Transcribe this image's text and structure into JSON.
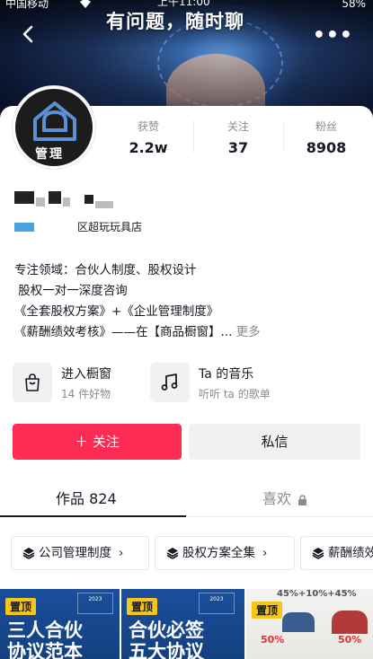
{
  "status_bar": {
    "carrier": "中国移动",
    "time": "上午11:00",
    "battery": "58%"
  },
  "banner": {
    "title": "有问题，随时聊",
    "more": "•••"
  },
  "avatar": {
    "label": "管理"
  },
  "stats": [
    {
      "label": "获赞",
      "value": "2.2w"
    },
    {
      "label": "关注",
      "value": "37"
    },
    {
      "label": "粉丝",
      "value": "8908"
    }
  ],
  "profile": {
    "location": "区超玩玩具店"
  },
  "bio": {
    "lines": [
      "专注领域：合伙人制度、股权设计",
      " 股权一对一深度咨询",
      "《全套股权方案》+《企业管理制度》",
      "《薪酬绩效考核》——在【商品橱窗】..."
    ],
    "more": "更多"
  },
  "services": [
    {
      "title": "进入橱窗",
      "subtitle": "14 件好物",
      "icon": "shopping-bag-icon"
    },
    {
      "title": "Ta 的音乐",
      "subtitle": "听听 ta 的歌单",
      "icon": "music-note-icon"
    }
  ],
  "actions": {
    "follow": "＋ 关注",
    "message": "私信"
  },
  "tabs": {
    "works": "作品 824",
    "likes": "喜欢"
  },
  "collections": [
    {
      "label": "公司管理制度"
    },
    {
      "label": "股权方案全集"
    },
    {
      "label": "薪酬绩效"
    }
  ],
  "thumbnails": [
    {
      "pin": "置顶",
      "text": "三人合伙\n协议范本",
      "book": "2023"
    },
    {
      "pin": "置顶",
      "text": "合伙必签\n五大协议",
      "book": "2023"
    },
    {
      "pin": "置顶",
      "top_text": "45%+10%+45%",
      "pct_left": "50%",
      "pct_right": "50%"
    }
  ],
  "colors": {
    "accent": "#fe2c55",
    "text": "#161823",
    "muted": "#8a8b91",
    "pin": "#f5c518"
  }
}
